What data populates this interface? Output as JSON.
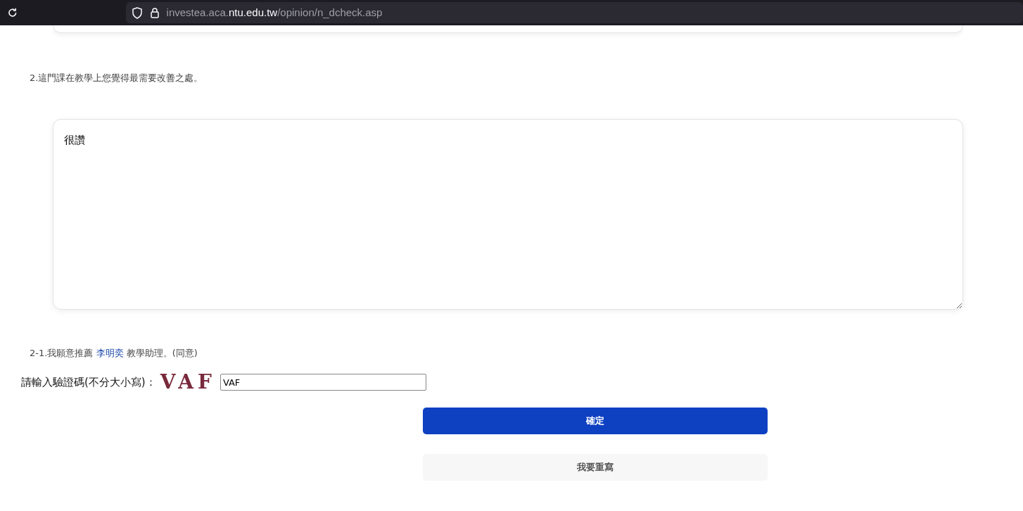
{
  "browser": {
    "url_prefix": "investea.aca.",
    "url_domain": "ntu.edu.tw",
    "url_path": "/opinion/n_dcheck.asp"
  },
  "question": {
    "text": "2.這門課在教學上您覺得最需要改善之處。",
    "answer": "很讚"
  },
  "recommend": {
    "before": "2-1.我願意推薦 ",
    "name": "李明奕",
    "after": " 教學助理。(同意)"
  },
  "captcha": {
    "label": "請輸入驗證碼(不分大小寫)：",
    "code": "VAF",
    "value": "VAF"
  },
  "buttons": [
    {
      "label": "確定",
      "kind": "primary"
    },
    {
      "label": "我要重寫",
      "kind": "secondary"
    }
  ]
}
